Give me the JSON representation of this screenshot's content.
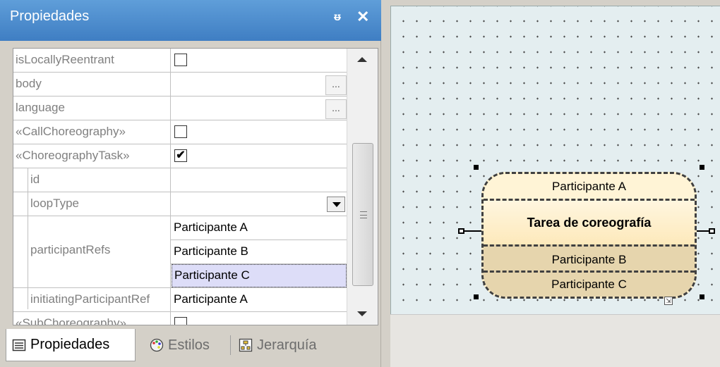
{
  "panel": {
    "title": "Propiedades",
    "pin_glyph": "ᵿ",
    "close_glyph": "✕"
  },
  "properties": [
    {
      "name": "isLocallyReentrant",
      "type": "checkbox",
      "checked": false
    },
    {
      "name": "body",
      "type": "ellipsis",
      "button": "..."
    },
    {
      "name": "language",
      "type": "ellipsis",
      "button": "..."
    },
    {
      "name": "«CallChoreography»",
      "type": "checkbox",
      "checked": false
    },
    {
      "name": "«ChoreographyTask»",
      "type": "checkbox",
      "checked": true
    },
    {
      "name": "id",
      "type": "text",
      "value": ""
    },
    {
      "name": "loopType",
      "type": "dropdown",
      "value": ""
    },
    {
      "name": "participantRefs",
      "type": "list",
      "values": [
        "Participante A",
        "Participante B",
        "Participante C"
      ],
      "selected_index": 2
    },
    {
      "name": "initiatingParticipantRef",
      "type": "text",
      "value": "Participante A"
    },
    {
      "name": "«SubChoreography»",
      "type": "checkbox",
      "checked": false
    }
  ],
  "tabs": [
    {
      "label": "Propiedades",
      "icon": "properties-icon",
      "active": true
    },
    {
      "label": "Estilos",
      "icon": "palette-icon",
      "active": false
    },
    {
      "label": "Jerarquía",
      "icon": "hierarchy-icon",
      "active": false
    }
  ],
  "diagram": {
    "top_participant": "Participante A",
    "task": "Tarea de coreografía",
    "bottom_participants": [
      "Participante B",
      "Participante C"
    ]
  },
  "colors": {
    "title_bar": "#4f8ecf",
    "selected_row": "#ddddf8",
    "task_fill": "#fff0cc",
    "participant_fill": "#e6d5ad"
  }
}
